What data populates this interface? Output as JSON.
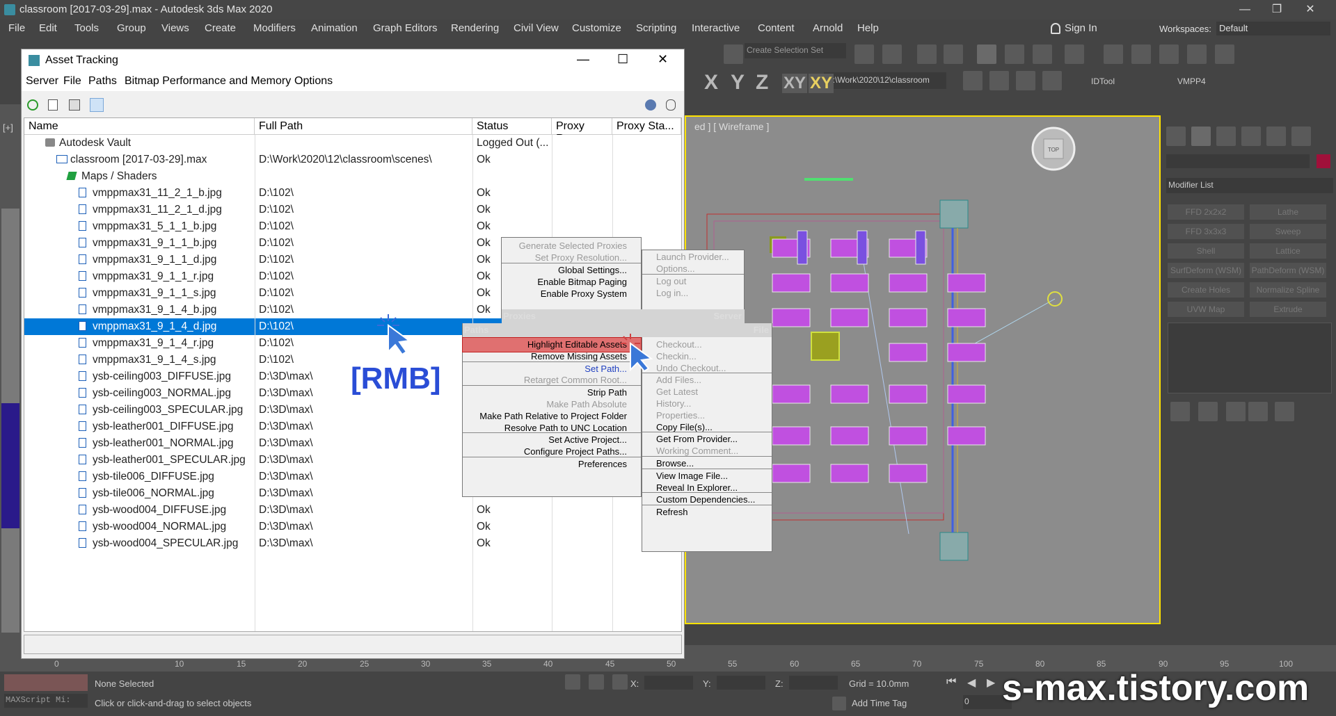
{
  "app": {
    "window_title": "classroom [2017-03-29].max - Autodesk 3ds Max 2020",
    "controls": {
      "minimize": "—",
      "restore": "❐",
      "close": "✕"
    },
    "menu": [
      "File",
      "Edit",
      "Tools",
      "Group",
      "Views",
      "Create",
      "Modifiers",
      "Animation",
      "Graph Editors",
      "Rendering",
      "Civil View",
      "Customize",
      "Scripting",
      "Interactive",
      "Content",
      "Arnold",
      "Help"
    ],
    "sign_in": "Sign In",
    "workspaces_label": "Workspaces:",
    "workspace_value": "Default",
    "selection_set": "Create Selection Set",
    "project_path": "D:\\Work\\2020\\12\\classroom",
    "idtool": "IDTool",
    "vmpp4": "VMPP4",
    "axes": [
      "X",
      "Y",
      "Z",
      "XY",
      "XY"
    ],
    "viewport_label": "[+]",
    "viewport_mode": "ed ] [ Wireframe ]",
    "viewcube_top": "TOP",
    "modifier_list": "Modifier List",
    "modifier_buttons": [
      "FFD 2x2x2",
      "Lathe",
      "FFD 3x3x3",
      "Sweep",
      "Shell",
      "Lattice",
      "SurfDeform (WSM)",
      "PathDeform (WSM)",
      "Create Holes",
      "Normalize Spline",
      "UVW Map",
      "Extrude"
    ],
    "timeline_ticks": [
      "0",
      "10",
      "15",
      "20",
      "25",
      "30",
      "35",
      "40",
      "45",
      "50",
      "55",
      "60",
      "65",
      "70",
      "75",
      "80",
      "85",
      "90",
      "95",
      "100"
    ],
    "status": {
      "none_selected": "None Selected",
      "prompt": "Click or click-and-drag to select objects",
      "maxscript": "MAXScript Mi:",
      "x_label": "X:",
      "y_label": "Y:",
      "z_label": "Z:",
      "grid": "Grid = 10.0mm",
      "add_time_tag": "Add Time Tag",
      "frame": "0"
    }
  },
  "dialog": {
    "title": "Asset Tracking",
    "menu": [
      "Server",
      "File",
      "Paths",
      "Bitmap Performance and Memory",
      "Options"
    ],
    "columns": [
      "Name",
      "Full Path",
      "Status",
      "Proxy Res...",
      "Proxy Sta..."
    ],
    "rows": [
      {
        "name": "Autodesk Vault",
        "path": "",
        "status": "Logged Out (...",
        "indent": 1,
        "icon": "vault-icon"
      },
      {
        "name": "classroom [2017-03-29].max",
        "path": "D:\\Work\\2020\\12\\classroom\\scenes\\",
        "status": "Ok",
        "indent": 2,
        "icon": "scene-icon"
      },
      {
        "name": "Maps / Shaders",
        "path": "",
        "status": "",
        "indent": 3,
        "icon": "maps-icon"
      },
      {
        "name": "vmppmax31_11_2_1_b.jpg",
        "path": "D:\\102\\",
        "status": "Ok",
        "indent": 4
      },
      {
        "name": "vmppmax31_11_2_1_d.jpg",
        "path": "D:\\102\\",
        "status": "Ok",
        "indent": 4
      },
      {
        "name": "vmppmax31_5_1_1_b.jpg",
        "path": "D:\\102\\",
        "status": "Ok",
        "indent": 4
      },
      {
        "name": "vmppmax31_9_1_1_b.jpg",
        "path": "D:\\102\\",
        "status": "Ok",
        "indent": 4
      },
      {
        "name": "vmppmax31_9_1_1_d.jpg",
        "path": "D:\\102\\",
        "status": "Ok",
        "indent": 4
      },
      {
        "name": "vmppmax31_9_1_1_r.jpg",
        "path": "D:\\102\\",
        "status": "Ok",
        "indent": 4
      },
      {
        "name": "vmppmax31_9_1_1_s.jpg",
        "path": "D:\\102\\",
        "status": "Ok",
        "indent": 4
      },
      {
        "name": "vmppmax31_9_1_4_b.jpg",
        "path": "D:\\102\\",
        "status": "Ok",
        "indent": 4
      },
      {
        "name": "vmppmax31_9_1_4_d.jpg",
        "path": "D:\\102\\",
        "status": "",
        "indent": 4,
        "selected": true
      },
      {
        "name": "vmppmax31_9_1_4_r.jpg",
        "path": "D:\\102\\",
        "status": "",
        "indent": 4
      },
      {
        "name": "vmppmax31_9_1_4_s.jpg",
        "path": "D:\\102\\",
        "status": "",
        "indent": 4
      },
      {
        "name": "ysb-ceiling003_DIFFUSE.jpg",
        "path": "D:\\3D\\max\\",
        "status": "",
        "indent": 4
      },
      {
        "name": "ysb-ceiling003_NORMAL.jpg",
        "path": "D:\\3D\\max\\",
        "status": "",
        "indent": 4
      },
      {
        "name": "ysb-ceiling003_SPECULAR.jpg",
        "path": "D:\\3D\\max\\",
        "status": "",
        "indent": 4
      },
      {
        "name": "ysb-leather001_DIFFUSE.jpg",
        "path": "D:\\3D\\max\\",
        "status": "",
        "indent": 4
      },
      {
        "name": "ysb-leather001_NORMAL.jpg",
        "path": "D:\\3D\\max\\",
        "status": "",
        "indent": 4
      },
      {
        "name": "ysb-leather001_SPECULAR.jpg",
        "path": "D:\\3D\\max\\",
        "status": "",
        "indent": 4
      },
      {
        "name": "ysb-tile006_DIFFUSE.jpg",
        "path": "D:\\3D\\max\\",
        "status": "",
        "indent": 4
      },
      {
        "name": "ysb-tile006_NORMAL.jpg",
        "path": "D:\\3D\\max\\",
        "status": "Ok",
        "indent": 4
      },
      {
        "name": "ysb-wood004_DIFFUSE.jpg",
        "path": "D:\\3D\\max\\",
        "status": "Ok",
        "indent": 4
      },
      {
        "name": "ysb-wood004_NORMAL.jpg",
        "path": "D:\\3D\\max\\",
        "status": "Ok",
        "indent": 4
      },
      {
        "name": "ysb-wood004_SPECULAR.jpg",
        "path": "D:\\3D\\max\\",
        "status": "Ok",
        "indent": 4
      }
    ]
  },
  "context_menu": {
    "proxies": {
      "header": "Proxies",
      "items": [
        {
          "label": "Generate Selected Proxies",
          "disabled": true
        },
        {
          "label": "Set Proxy Resolution...",
          "disabled": true
        },
        {
          "label": "Global Settings...",
          "disabled": false
        },
        {
          "label": "Enable Bitmap Paging",
          "disabled": false
        },
        {
          "label": "Enable Proxy System",
          "disabled": false
        }
      ]
    },
    "server": {
      "header": "Server",
      "items": [
        {
          "label": "Launch Provider...",
          "disabled": true
        },
        {
          "label": "Options...",
          "disabled": true
        },
        {
          "label": "Log out",
          "disabled": true
        },
        {
          "label": "Log in...",
          "disabled": true
        }
      ]
    },
    "paths": {
      "header": "Paths",
      "items": [
        {
          "label": "Highlight Editable Assets",
          "disabled": false,
          "highlighted": true
        },
        {
          "label": "Remove Missing Assets",
          "disabled": false
        },
        {
          "label": "Set Path...",
          "disabled": false,
          "accent": true
        },
        {
          "label": "Retarget Common Root...",
          "disabled": true
        },
        {
          "label": "Strip Path",
          "disabled": false
        },
        {
          "label": "Make Path Absolute",
          "disabled": true
        },
        {
          "label": "Make Path Relative to Project Folder",
          "disabled": false
        },
        {
          "label": "Resolve Path to UNC Location",
          "disabled": false
        },
        {
          "label": "Set Active Project...",
          "disabled": false
        },
        {
          "label": "Configure Project Paths...",
          "disabled": false
        },
        {
          "label": "Preferences",
          "disabled": false
        }
      ]
    },
    "file": {
      "header": "File",
      "items": [
        {
          "label": "Checkout...",
          "disabled": true
        },
        {
          "label": "Checkin...",
          "disabled": true
        },
        {
          "label": "Undo Checkout...",
          "disabled": true
        },
        {
          "label": "Add Files...",
          "disabled": true
        },
        {
          "label": "Get Latest",
          "disabled": true
        },
        {
          "label": "History...",
          "disabled": true
        },
        {
          "label": "Properties...",
          "disabled": true
        },
        {
          "label": "Copy File(s)...",
          "disabled": false
        },
        {
          "label": "Get From Provider...",
          "disabled": false
        },
        {
          "label": "Working Comment...",
          "disabled": true
        },
        {
          "label": "Browse...",
          "disabled": false
        },
        {
          "label": "View Image File...",
          "disabled": false
        },
        {
          "label": "Reveal In Explorer...",
          "disabled": false
        },
        {
          "label": "Custom Dependencies...",
          "disabled": false
        },
        {
          "label": "Refresh",
          "disabled": false
        }
      ]
    }
  },
  "overlay": {
    "rmb_label": "[RMB]",
    "watermark": "s-max.tistory.com"
  },
  "colors": {
    "selection_blue": "#0078d7",
    "highlight_red": "#e07070",
    "viewport_border": "#ffe200",
    "rmb_blue": "#2a4dd6"
  }
}
